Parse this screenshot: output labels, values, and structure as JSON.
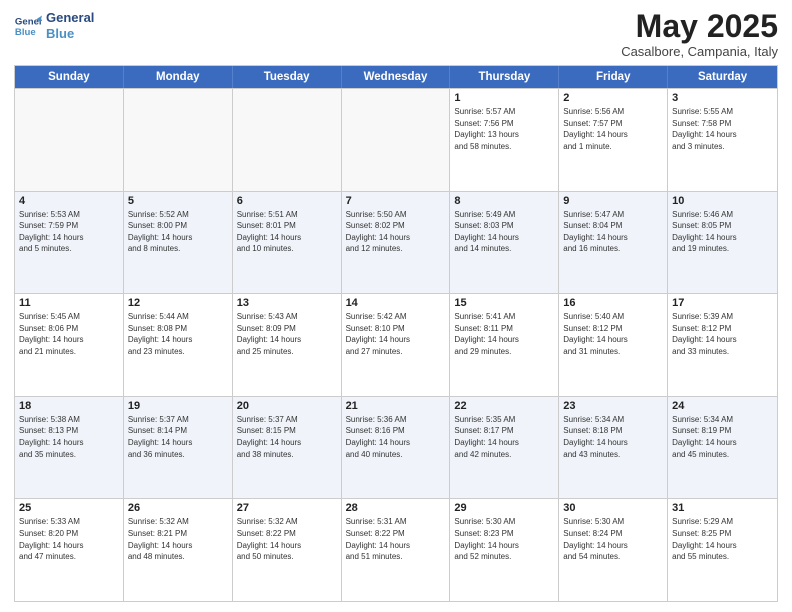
{
  "logo": {
    "line1": "General",
    "line2": "Blue"
  },
  "title": "May 2025",
  "subtitle": "Casalbore, Campania, Italy",
  "weekdays": [
    "Sunday",
    "Monday",
    "Tuesday",
    "Wednesday",
    "Thursday",
    "Friday",
    "Saturday"
  ],
  "weeks": [
    [
      {
        "day": "",
        "info": "",
        "empty": true
      },
      {
        "day": "",
        "info": "",
        "empty": true
      },
      {
        "day": "",
        "info": "",
        "empty": true
      },
      {
        "day": "",
        "info": "",
        "empty": true
      },
      {
        "day": "1",
        "info": "Sunrise: 5:57 AM\nSunset: 7:56 PM\nDaylight: 13 hours\nand 58 minutes.",
        "empty": false
      },
      {
        "day": "2",
        "info": "Sunrise: 5:56 AM\nSunset: 7:57 PM\nDaylight: 14 hours\nand 1 minute.",
        "empty": false
      },
      {
        "day": "3",
        "info": "Sunrise: 5:55 AM\nSunset: 7:58 PM\nDaylight: 14 hours\nand 3 minutes.",
        "empty": false
      }
    ],
    [
      {
        "day": "4",
        "info": "Sunrise: 5:53 AM\nSunset: 7:59 PM\nDaylight: 14 hours\nand 5 minutes.",
        "empty": false
      },
      {
        "day": "5",
        "info": "Sunrise: 5:52 AM\nSunset: 8:00 PM\nDaylight: 14 hours\nand 8 minutes.",
        "empty": false
      },
      {
        "day": "6",
        "info": "Sunrise: 5:51 AM\nSunset: 8:01 PM\nDaylight: 14 hours\nand 10 minutes.",
        "empty": false
      },
      {
        "day": "7",
        "info": "Sunrise: 5:50 AM\nSunset: 8:02 PM\nDaylight: 14 hours\nand 12 minutes.",
        "empty": false
      },
      {
        "day": "8",
        "info": "Sunrise: 5:49 AM\nSunset: 8:03 PM\nDaylight: 14 hours\nand 14 minutes.",
        "empty": false
      },
      {
        "day": "9",
        "info": "Sunrise: 5:47 AM\nSunset: 8:04 PM\nDaylight: 14 hours\nand 16 minutes.",
        "empty": false
      },
      {
        "day": "10",
        "info": "Sunrise: 5:46 AM\nSunset: 8:05 PM\nDaylight: 14 hours\nand 19 minutes.",
        "empty": false
      }
    ],
    [
      {
        "day": "11",
        "info": "Sunrise: 5:45 AM\nSunset: 8:06 PM\nDaylight: 14 hours\nand 21 minutes.",
        "empty": false
      },
      {
        "day": "12",
        "info": "Sunrise: 5:44 AM\nSunset: 8:08 PM\nDaylight: 14 hours\nand 23 minutes.",
        "empty": false
      },
      {
        "day": "13",
        "info": "Sunrise: 5:43 AM\nSunset: 8:09 PM\nDaylight: 14 hours\nand 25 minutes.",
        "empty": false
      },
      {
        "day": "14",
        "info": "Sunrise: 5:42 AM\nSunset: 8:10 PM\nDaylight: 14 hours\nand 27 minutes.",
        "empty": false
      },
      {
        "day": "15",
        "info": "Sunrise: 5:41 AM\nSunset: 8:11 PM\nDaylight: 14 hours\nand 29 minutes.",
        "empty": false
      },
      {
        "day": "16",
        "info": "Sunrise: 5:40 AM\nSunset: 8:12 PM\nDaylight: 14 hours\nand 31 minutes.",
        "empty": false
      },
      {
        "day": "17",
        "info": "Sunrise: 5:39 AM\nSunset: 8:12 PM\nDaylight: 14 hours\nand 33 minutes.",
        "empty": false
      }
    ],
    [
      {
        "day": "18",
        "info": "Sunrise: 5:38 AM\nSunset: 8:13 PM\nDaylight: 14 hours\nand 35 minutes.",
        "empty": false
      },
      {
        "day": "19",
        "info": "Sunrise: 5:37 AM\nSunset: 8:14 PM\nDaylight: 14 hours\nand 36 minutes.",
        "empty": false
      },
      {
        "day": "20",
        "info": "Sunrise: 5:37 AM\nSunset: 8:15 PM\nDaylight: 14 hours\nand 38 minutes.",
        "empty": false
      },
      {
        "day": "21",
        "info": "Sunrise: 5:36 AM\nSunset: 8:16 PM\nDaylight: 14 hours\nand 40 minutes.",
        "empty": false
      },
      {
        "day": "22",
        "info": "Sunrise: 5:35 AM\nSunset: 8:17 PM\nDaylight: 14 hours\nand 42 minutes.",
        "empty": false
      },
      {
        "day": "23",
        "info": "Sunrise: 5:34 AM\nSunset: 8:18 PM\nDaylight: 14 hours\nand 43 minutes.",
        "empty": false
      },
      {
        "day": "24",
        "info": "Sunrise: 5:34 AM\nSunset: 8:19 PM\nDaylight: 14 hours\nand 45 minutes.",
        "empty": false
      }
    ],
    [
      {
        "day": "25",
        "info": "Sunrise: 5:33 AM\nSunset: 8:20 PM\nDaylight: 14 hours\nand 47 minutes.",
        "empty": false
      },
      {
        "day": "26",
        "info": "Sunrise: 5:32 AM\nSunset: 8:21 PM\nDaylight: 14 hours\nand 48 minutes.",
        "empty": false
      },
      {
        "day": "27",
        "info": "Sunrise: 5:32 AM\nSunset: 8:22 PM\nDaylight: 14 hours\nand 50 minutes.",
        "empty": false
      },
      {
        "day": "28",
        "info": "Sunrise: 5:31 AM\nSunset: 8:22 PM\nDaylight: 14 hours\nand 51 minutes.",
        "empty": false
      },
      {
        "day": "29",
        "info": "Sunrise: 5:30 AM\nSunset: 8:23 PM\nDaylight: 14 hours\nand 52 minutes.",
        "empty": false
      },
      {
        "day": "30",
        "info": "Sunrise: 5:30 AM\nSunset: 8:24 PM\nDaylight: 14 hours\nand 54 minutes.",
        "empty": false
      },
      {
        "day": "31",
        "info": "Sunrise: 5:29 AM\nSunset: 8:25 PM\nDaylight: 14 hours\nand 55 minutes.",
        "empty": false
      }
    ]
  ]
}
